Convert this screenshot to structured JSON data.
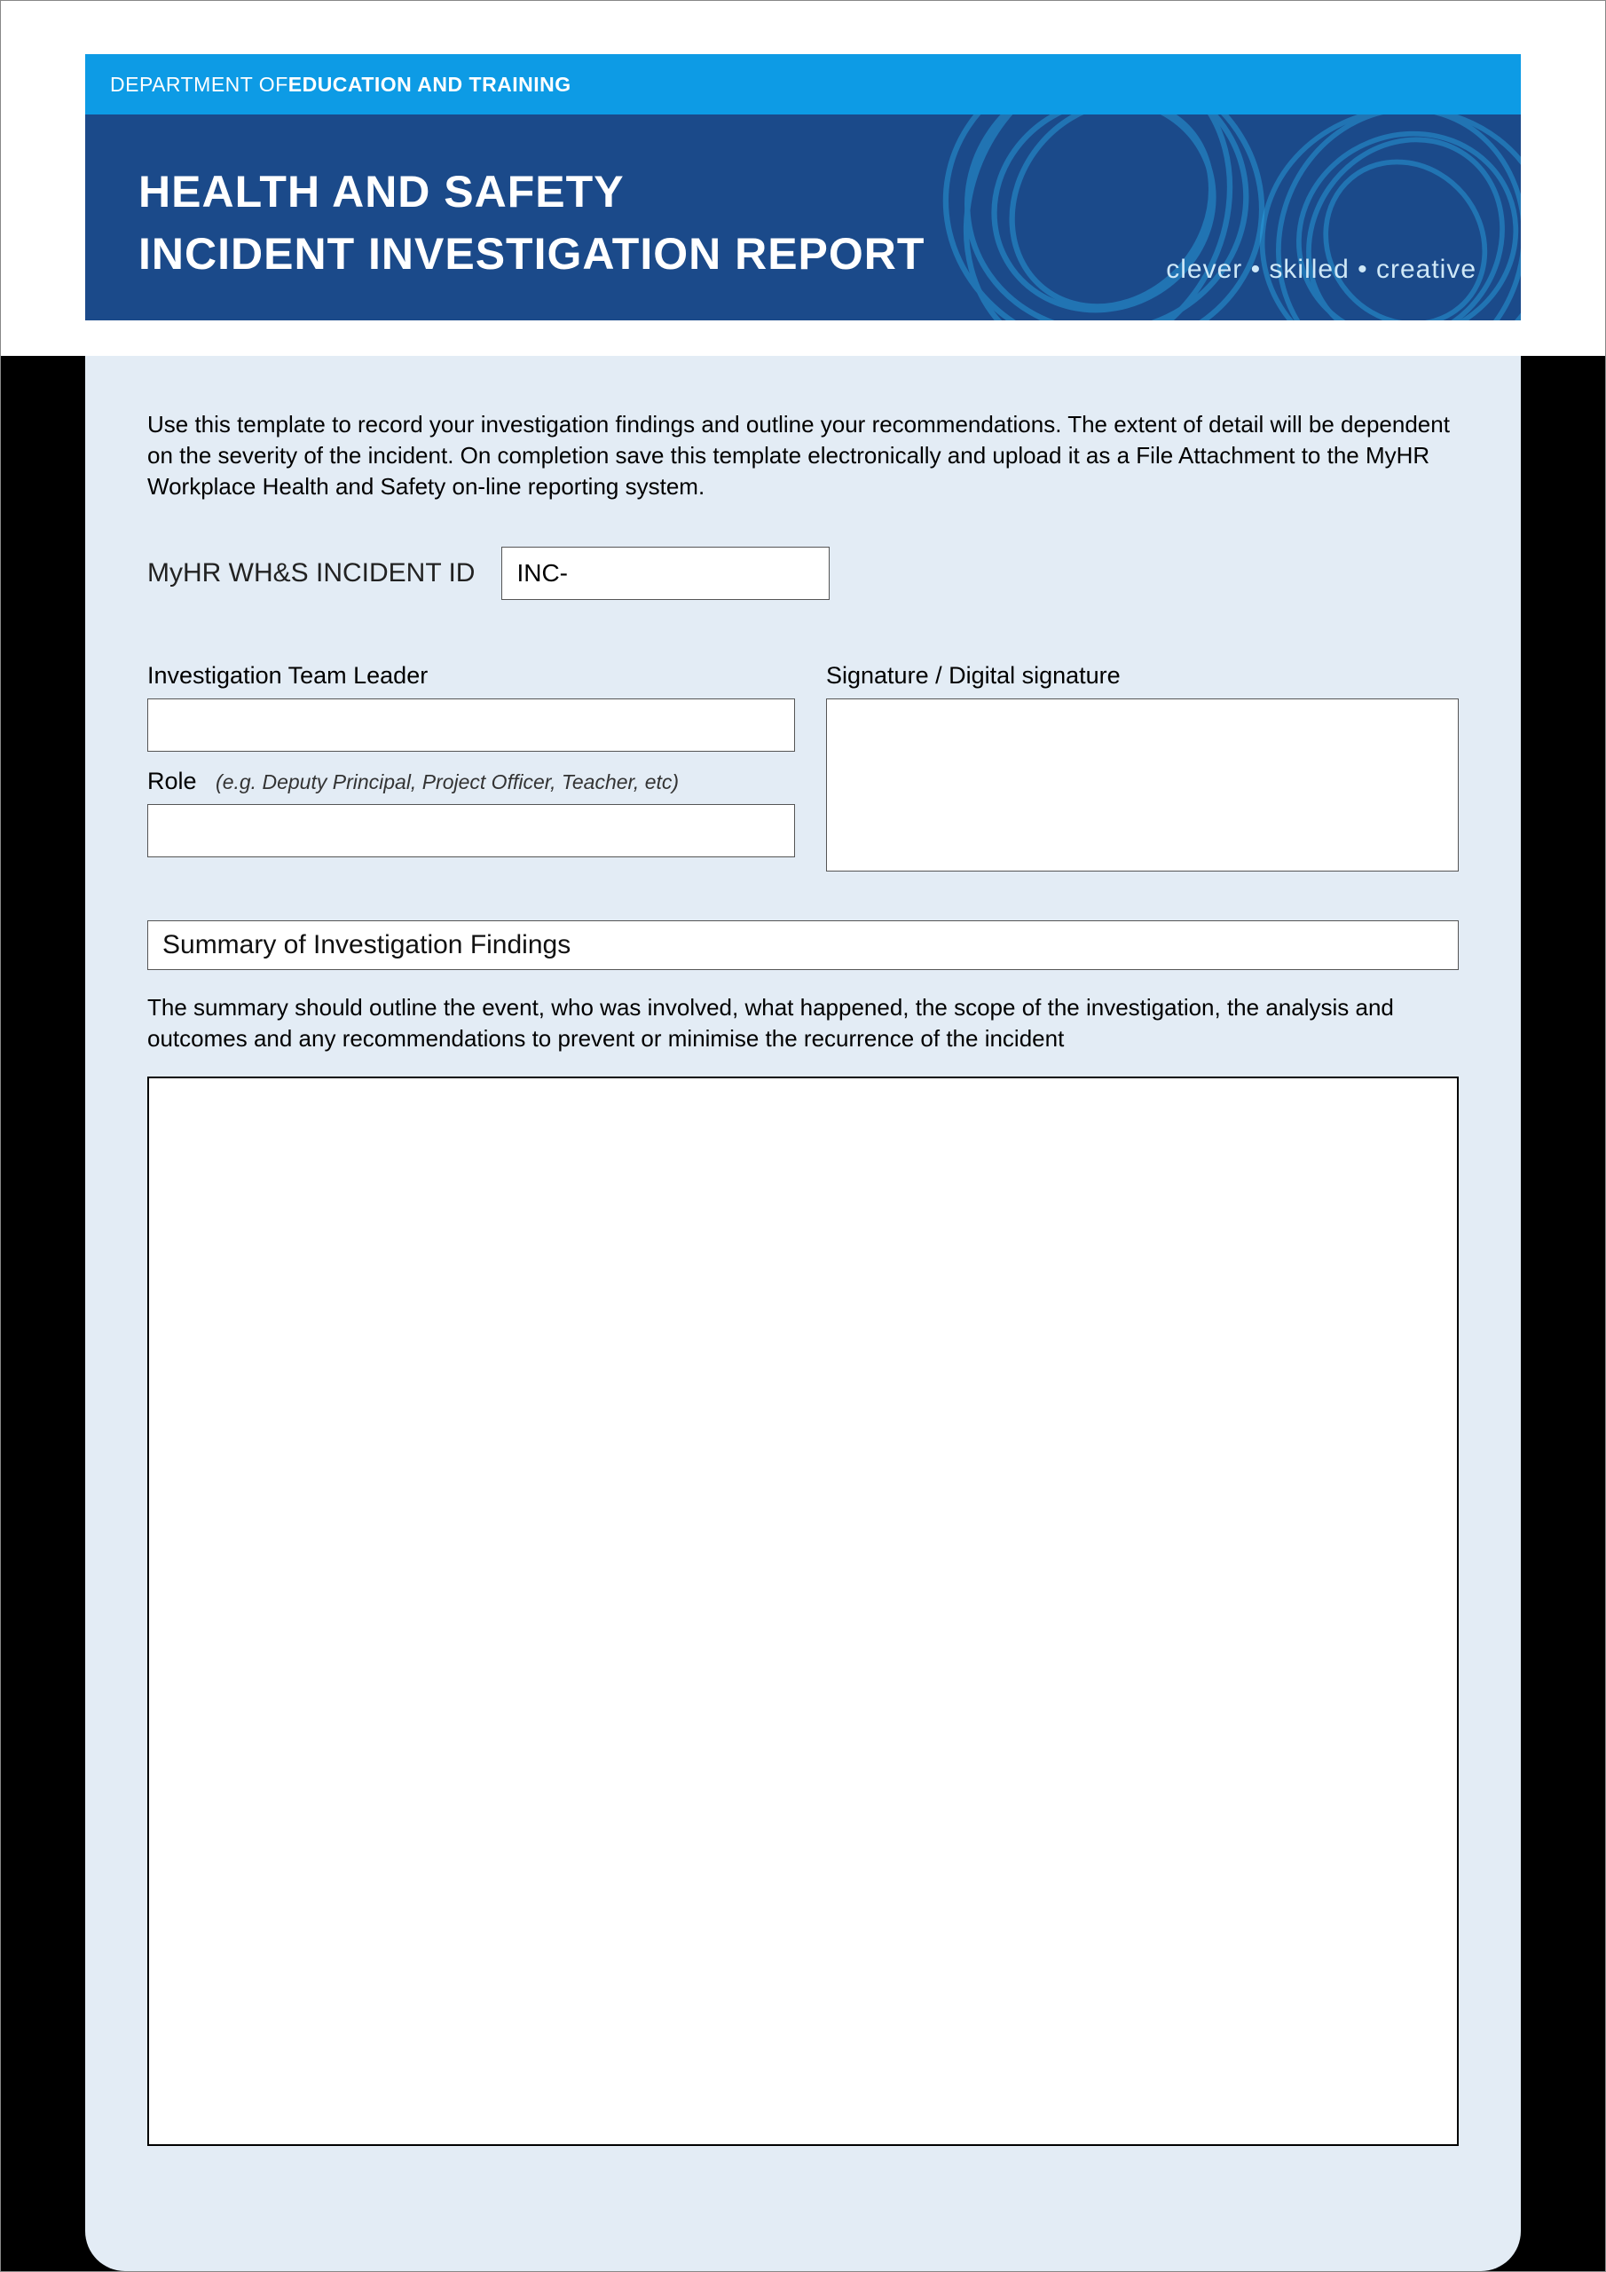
{
  "banner": {
    "dept_thin": "DEPARTMENT OF ",
    "dept_bold": "EDUCATION AND TRAINING",
    "title_line1": "HEALTH AND SAFETY",
    "title_line2": "INCIDENT INVESTIGATION REPORT",
    "tagline": "clever • skilled • creative"
  },
  "intro": "Use this template to record your investigation findings and outline your recommendations. The extent of detail will be dependent on the severity of the incident. On completion save this template electronically and upload it as a File Attachment to the MyHR Workplace Health and Safety on-line reporting system.",
  "incident": {
    "label": "MyHR WH&S INCIDENT ID",
    "value": "INC-"
  },
  "team_leader": {
    "label": "Investigation Team Leader",
    "value": ""
  },
  "signature": {
    "label": "Signature / Digital signature"
  },
  "role": {
    "label": "Role",
    "hint": "(e.g. Deputy Principal, Project Officer, Teacher, etc)",
    "value": ""
  },
  "summary": {
    "header": "Summary of Investigation Findings",
    "description": "The summary should outline the event, who was involved, what happened, the scope of the investigation, the analysis and outcomes and any recommendations to prevent or minimise the recurrence of the incident",
    "value": ""
  }
}
